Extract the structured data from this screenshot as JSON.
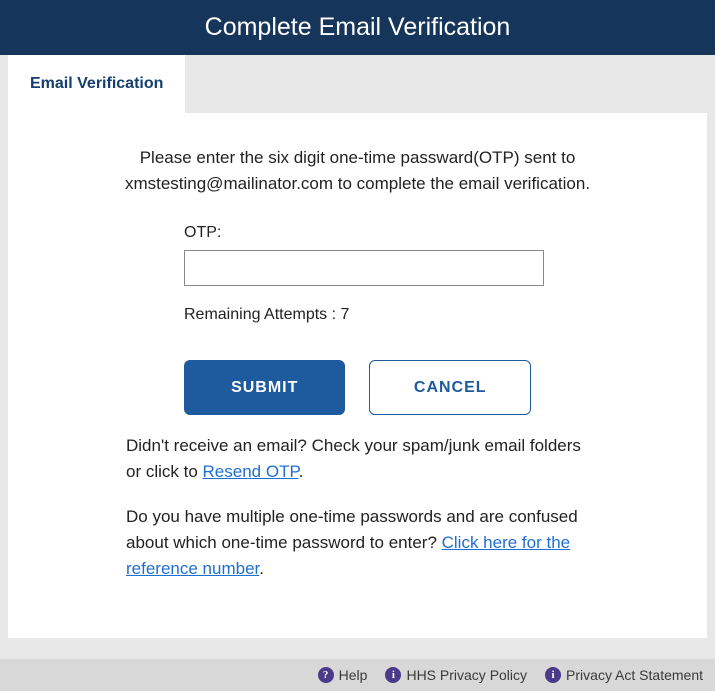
{
  "header": {
    "title": "Complete Email Verification"
  },
  "tab": {
    "label": "Email Verification"
  },
  "main": {
    "instruction": "Please enter the six digit one-time passward(OTP) sent to xmstesting@mailinator.com to complete the email verification.",
    "otp_label": "OTP:",
    "otp_value": "",
    "remaining_attempts_label": "Remaining Attempts : 7",
    "submit_label": "SUBMIT",
    "cancel_label": "CANCEL",
    "resend_text_prefix": "Didn't receive an email? Check your spam/junk email folders or click to ",
    "resend_link": "Resend OTP",
    "resend_text_suffix": ".",
    "reference_text": "Do you have multiple one-time passwords and are confused about which one-time password to enter? ",
    "reference_link": "Click here for the reference number",
    "reference_suffix": "."
  },
  "footer": {
    "help_label": "Help",
    "hhs_label": "HHS Privacy Policy",
    "privacy_label": "Privacy Act Statement"
  }
}
